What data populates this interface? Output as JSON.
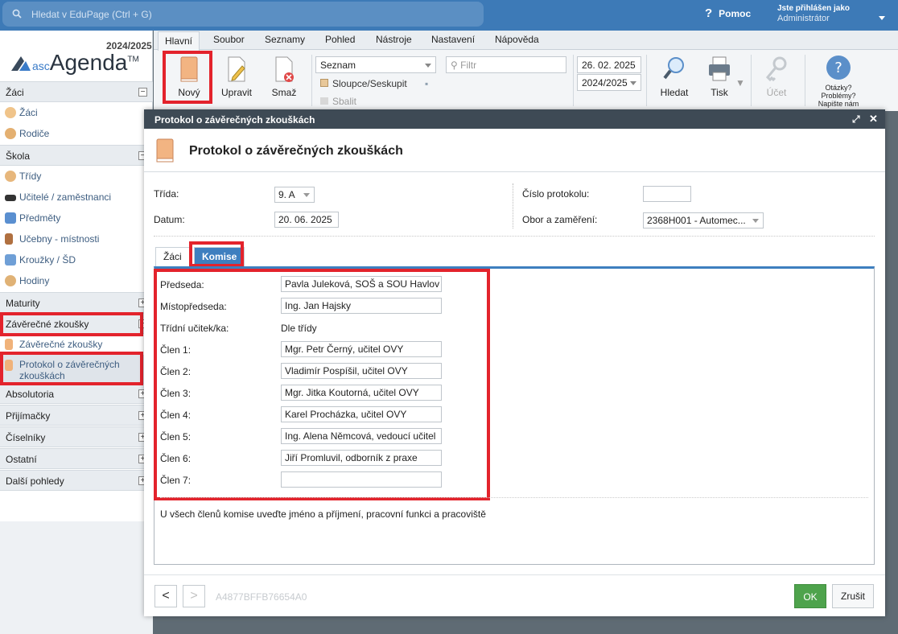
{
  "topbar": {
    "search_placeholder": "Hledat v EduPage (Ctrl + G)",
    "help_label": "Pomoc",
    "user_prefix": "Jste přihlášen jako",
    "user_name": "Administrátor"
  },
  "logo": {
    "year": "2024/2025",
    "prefix": "asc",
    "name": "Agenda",
    "tm": "TM"
  },
  "sidebar": {
    "sections": [
      {
        "label": "Žáci",
        "toggle": "−"
      },
      {
        "label": "Škola",
        "toggle": "−"
      },
      {
        "label": "Maturity",
        "toggle": "+"
      },
      {
        "label": "Závěrečné zkoušky",
        "toggle": "−"
      },
      {
        "label": "Absolutoria",
        "toggle": "+"
      },
      {
        "label": "Přijímačky",
        "toggle": "+"
      },
      {
        "label": "Číselníky",
        "toggle": "+"
      },
      {
        "label": "Ostatní",
        "toggle": "+"
      },
      {
        "label": "Další pohledy",
        "toggle": "+"
      }
    ],
    "items": [
      {
        "label": "Žáci"
      },
      {
        "label": "Rodiče"
      },
      {
        "label": "Třídy"
      },
      {
        "label": "Učitelé / zaměstnanci"
      },
      {
        "label": "Předměty"
      },
      {
        "label": "Učebny - místnosti"
      },
      {
        "label": "Kroužky / ŠD"
      },
      {
        "label": "Hodiny"
      },
      {
        "label": "Závěrečné zkoušky"
      },
      {
        "label": "Protokol o závěrečných zkouškách"
      }
    ]
  },
  "ribbon": {
    "tabs": [
      "Hlavní",
      "Soubor",
      "Seznamy",
      "Pohled",
      "Nástroje",
      "Nastavení",
      "Nápověda"
    ],
    "new_label": "Nový",
    "edit_label": "Upravit",
    "delete_label": "Smaž",
    "view_select": "Seznam",
    "columns_label": "Sloupce/Seskupit",
    "collapse_label": "Sbalit",
    "filter_placeholder": "Filtr",
    "date_value": "26. 02. 2025",
    "year_value": "2024/2025",
    "find_label": "Hledat",
    "print_label": "Tisk",
    "account_label": "Účet",
    "questions_label": "Otázky? Problémy? Napište nám"
  },
  "modal": {
    "title": "Protokol o závěrečných zkouškách",
    "heading": "Protokol o závěrečných zkouškách",
    "class_label": "Třída:",
    "class_value": "9. A",
    "date_label": "Datum:",
    "date_value": "20. 06. 2025",
    "protocol_label": "Číslo protokolu:",
    "protocol_value": "",
    "field_label": "Obor a zaměření:",
    "field_value": "2368H001 - Automec...",
    "tabs": [
      "Žáci",
      "Komise"
    ],
    "committee": [
      {
        "label": "Předseda:",
        "value": "Pavla Juleková, SOŠ a SOU Havlov"
      },
      {
        "label": "Místopředseda:",
        "value": "Ing. Jan Hajsky"
      },
      {
        "label": "Třídní učitek/ka:",
        "value": "Dle třídy"
      },
      {
        "label": "Člen 1:",
        "value": "Mgr. Petr Černý, učitel OVY"
      },
      {
        "label": "Člen 2:",
        "value": "Vladimír Pospíšil, učitel OVY"
      },
      {
        "label": "Člen 3:",
        "value": "Mgr. Jitka Koutorná, učitel OVY"
      },
      {
        "label": "Člen 4:",
        "value": "Karel Procházka, učitel OVY"
      },
      {
        "label": "Člen 5:",
        "value": "Ing. Alena Němcová, vedoucí učitel"
      },
      {
        "label": "Člen 6:",
        "value": "Jiří Promluvil, odborník z praxe"
      },
      {
        "label": "Člen 7:",
        "value": ""
      }
    ],
    "note": "U všech členů komise uveďte jméno a příjmení, pracovní funkci a pracoviště",
    "prev": "<",
    "next": ">",
    "record_id": "A4877BFFB76654A0",
    "ok_label": "OK",
    "cancel_label": "Zrušit"
  },
  "colors": {
    "accent": "#3d7ab7",
    "highlight": "#e3232c",
    "ok": "#4ea34c",
    "modal_title": "#3e4a55"
  }
}
